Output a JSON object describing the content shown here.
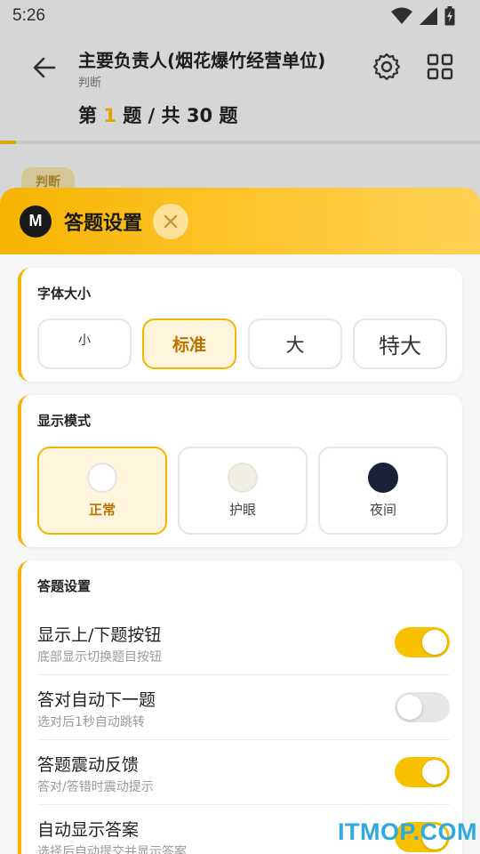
{
  "status": {
    "time": "5:26"
  },
  "header": {
    "title": "主要负责人(烟花爆竹经营单位)",
    "subtitle": "判断",
    "progress_prefix": "第",
    "current": "1",
    "progress_mid": "题 / 共",
    "total": "30",
    "progress_suffix": "题",
    "progress_fraction": 0.033
  },
  "background": {
    "chip": "判断"
  },
  "sheet": {
    "badge": "M",
    "title": "答题设置",
    "font_size": {
      "title": "字体大小",
      "options": [
        "小",
        "标准",
        "大",
        "特大"
      ],
      "selected": "标准"
    },
    "display_mode": {
      "title": "显示模式",
      "options": [
        {
          "label": "正常",
          "color": "#ffffff"
        },
        {
          "label": "护眼",
          "color": "#f3eee2"
        },
        {
          "label": "夜间",
          "color": "#1c2138"
        }
      ],
      "selected": "正常"
    },
    "answer_settings": {
      "title": "答题设置",
      "items": [
        {
          "title": "显示上/下题按钮",
          "desc": "底部显示切换题目按钮",
          "on": true
        },
        {
          "title": "答对自动下一题",
          "desc": "选对后1秒自动跳转",
          "on": false
        },
        {
          "title": "答题震动反馈",
          "desc": "答对/答错时震动提示",
          "on": true
        },
        {
          "title": "自动显示答案",
          "desc": "选择后自动提交并显示答案",
          "on": true
        }
      ]
    }
  },
  "watermark": "ITMOP.COM",
  "colors": {
    "accent": "#f5b400",
    "accent_light": "#fff5dd",
    "selected_text": "#b57500"
  }
}
